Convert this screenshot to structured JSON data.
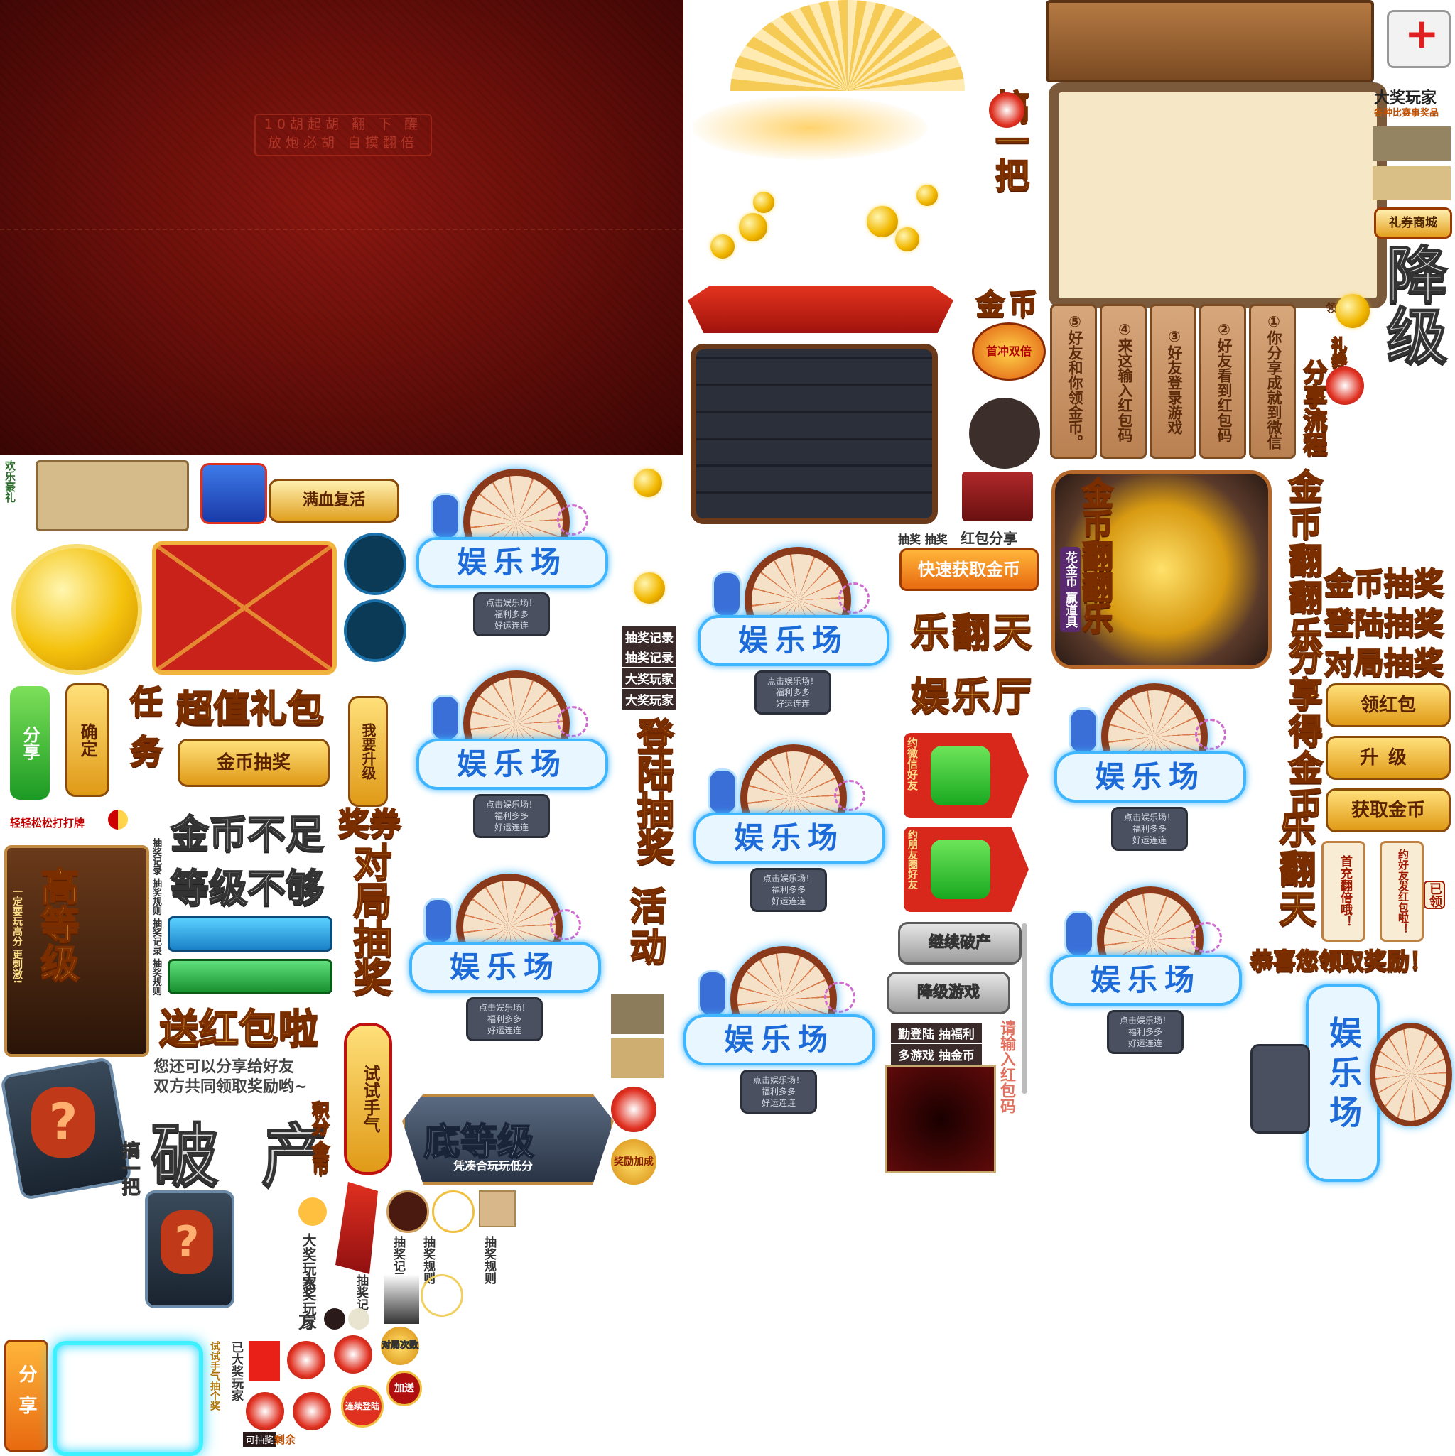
{
  "panel": {
    "rule_line1": "10胡起胡 翻 下 醒",
    "rule_line2": "放炮必胡 自摸翻倍"
  },
  "wheel_cards": {
    "title": "娱乐场",
    "plaque": "点击娱乐场！\n福利多多\n好运连连"
  },
  "left_column": {
    "smile_label": "欢乐豪礼",
    "revive": "满血复活",
    "share_btn": "分享",
    "confirm_btn": "确定",
    "task": "任务",
    "super_gift": "超值礼包",
    "coin_lottery_btn": "金币抽奖",
    "upgrade_btn": "我要升级",
    "coupon": "奖券",
    "tip": "轻轻松松打打牌",
    "coin_short": "金币不足",
    "level_short": "等级不够",
    "duiju_lottery": "对局抽奖",
    "send_redpacket": "送红包啦",
    "share_hint_1": "您还可以分享给好友",
    "share_hint_2": "双方共同领取奖励哟~",
    "bankrupt": "破产",
    "try_luck": "试试手气",
    "points_coin": "积分 金币",
    "high_level": "高等级",
    "high_level_sub": "一定要玩高分  更刺激!",
    "low_level": "底等级",
    "low_level_sub": "凭凑合玩玩低分",
    "vertical_list": [
      "抽奖记录",
      "抽奖规则",
      "抽奖记录",
      "抽奖规则"
    ],
    "grab": "搞一把",
    "share_vertical": "分享",
    "big_winner": "大奖玩家",
    "wan": "万",
    "lottery_rules": "抽奖规则",
    "lottery_record": "抽奖记录",
    "already_winner": "已大奖玩家",
    "try_tag": "试试手气抽个奖",
    "can_draw": "可抽奖",
    "remaining": "剩余",
    "duiju_times": "对局次数",
    "bonus_add": "加送",
    "continuous": "连续登陆"
  },
  "middle_column": {
    "lottery_record": "抽奖记录",
    "lottery_record2": "抽奖记录",
    "big_winner": "大奖玩家",
    "big_winner2": "大奖玩家",
    "login_lottery": "登陆抽奖",
    "activity": "活动",
    "bonus_badge": "奖励加成",
    "grab": "搞一把",
    "coin": "金币",
    "double_badge": "首冲双倍",
    "lottery_label": "抽奖 抽奖",
    "redpacket_share": "红包分享",
    "fast_coin": "快速获取金币",
    "le_fan_tian": "乐翻天",
    "yu_le_ting": "娱乐厅",
    "wechat_invite": "约微信好友",
    "moments_invite": "约朋友圈好友",
    "continue_bankrupt": "继续破产",
    "downgrade_game": "降级游戏",
    "diligent_login": "勤登陆 抽福利",
    "more_games": "多游戏 抽金币",
    "enter_redpacket": "请输入红包码"
  },
  "right_column": {
    "big_winner_title": "大奖玩家",
    "big_winner_sub": "各种比赛事奖品",
    "gift_shop": "礼券商城",
    "downgrade": "降级",
    "claim": "领取",
    "gift": "礼券",
    "share_flow": "分享流程",
    "steps": [
      "①你分享成就到微信",
      "②好友看到红包码",
      "③好友登录游戏",
      "④来这输入红包码",
      "⑤好友和你领金币。"
    ],
    "coin_fanfan": "金币翻翻乐",
    "coin_fanfan_sub": "花金币 赢道具",
    "coin_fan_le": "金币翻翻乐",
    "share_coin": "分享得金币",
    "le_fan_tian": "乐翻天",
    "coin_lottery": "金币抽奖",
    "login_lottery": "登陆抽奖",
    "duiju_lottery": "对局抽奖",
    "get_redpacket": "领红包",
    "upgrade": "升级",
    "get_coin": "获取金币",
    "first_recharge": "首充翻倍哦！",
    "invite_friends": "约好友发红包啦！",
    "claimed": "已领",
    "congrats": "恭喜您领取奖励！"
  }
}
